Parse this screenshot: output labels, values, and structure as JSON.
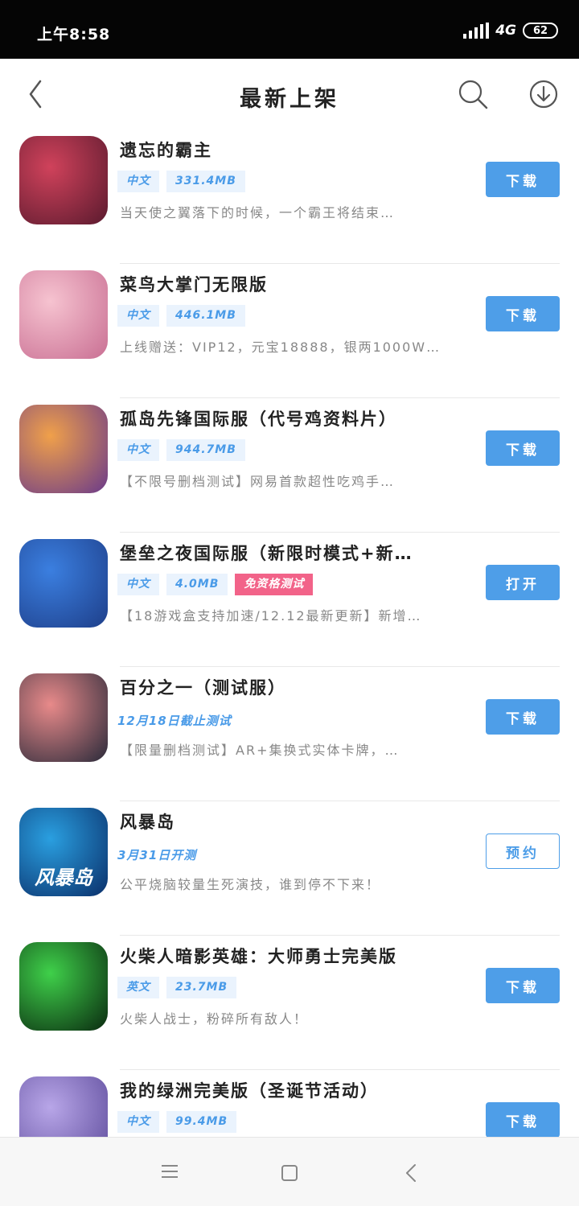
{
  "status_bar": {
    "time": "上午8:58",
    "network": "4G",
    "battery": "62"
  },
  "header": {
    "title": "最新上架"
  },
  "apps": [
    {
      "name": "遗忘的霸主",
      "tags": [
        "中文",
        "331.4MB"
      ],
      "desc": "当天使之翼落下的时候，一个霸王将结束…",
      "button": "下载",
      "button_style": "primary",
      "icon_colors": [
        "#d0425b",
        "#5a1a2e"
      ]
    },
    {
      "name": "菜鸟大掌门无限版",
      "tags": [
        "中文",
        "446.1MB"
      ],
      "desc": "上线赠送：VIP12，元宝18888，银两1000W…",
      "button": "下载",
      "button_style": "primary",
      "icon_colors": [
        "#f6c3d0",
        "#c96f93"
      ]
    },
    {
      "name": "孤岛先锋国际服（代号鸡资料片）",
      "tags": [
        "中文",
        "944.7MB"
      ],
      "desc": "【不限号删档测试】网易首款超性吃鸡手…",
      "button": "下载",
      "button_style": "primary",
      "icon_colors": [
        "#f0a04a",
        "#6a3a8a"
      ]
    },
    {
      "name": "堡垒之夜国际服（新限时模式+新…",
      "tags": [
        "中文",
        "4.0MB"
      ],
      "badge": "免资格测试",
      "desc": "【18游戏盒支持加速/12.12最新更新】新增…",
      "button": "打开",
      "button_style": "primary",
      "icon_colors": [
        "#3b7fe0",
        "#1e3f8a"
      ]
    },
    {
      "name": "百分之一（测试服）",
      "date_note": "12月18日截止测试",
      "desc": "【限量删档测试】AR+集换式实体卡牌，…",
      "button": "下载",
      "button_style": "primary",
      "icon_colors": [
        "#e88a8a",
        "#2a2a3a"
      ]
    },
    {
      "name": "风暴岛",
      "date_note": "3月31日开测",
      "desc": "公平烧脑较量生死演技，谁到停不下来！",
      "button": "预约",
      "button_style": "outline",
      "icon_colors": [
        "#2a9fe0",
        "#0a2f6a"
      ],
      "icon_text": "风暴岛"
    },
    {
      "name": "火柴人暗影英雄：大师勇士完美版",
      "tags": [
        "英文",
        "23.7MB"
      ],
      "desc": "火柴人战士，粉碎所有敌人！",
      "button": "下载",
      "button_style": "primary",
      "icon_colors": [
        "#3fd04a",
        "#0a2a10"
      ]
    },
    {
      "name": "我的绿洲完美版（圣诞节活动）",
      "tags": [
        "中文",
        "99.4MB"
      ],
      "desc": "",
      "button": "下载",
      "button_style": "primary",
      "icon_colors": [
        "#b8a6e8",
        "#5c4a9a"
      ]
    }
  ]
}
